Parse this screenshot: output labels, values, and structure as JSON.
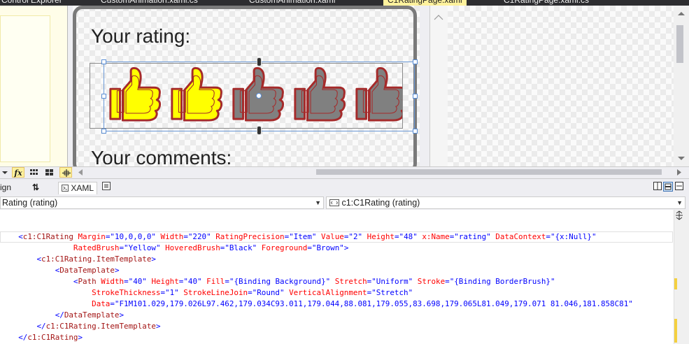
{
  "doc_tabs": [
    {
      "label": "Control Explorer",
      "active": false
    },
    {
      "label": "CustomAnimation.xaml.cs",
      "active": false
    },
    {
      "label": "CustomAnimation.xaml",
      "active": false
    },
    {
      "label": "C1RatingPage.xaml",
      "active": true
    },
    {
      "label": "C1RatingPage.xaml.cs",
      "active": false
    }
  ],
  "designer": {
    "your_rating": "Your rating:",
    "your_comments": "Your comments:",
    "rating": {
      "value": 2,
      "max": 5,
      "rated_fill": "#ffff00",
      "unrated_fill": "#808080",
      "stroke": "#a52a2a"
    }
  },
  "toolbar": {
    "fx_label": "fx"
  },
  "split": {
    "design_label": "ign",
    "swap_label": "⇅",
    "xaml_label": "XAML"
  },
  "combos": {
    "left": "Rating (rating)",
    "right": "c1:C1Rating (rating)"
  },
  "code": {
    "lines": [
      "",
      "",
      "",
      "",
      "",
      "",
      "",
      "",
      "",
      "",
      "",
      ""
    ],
    "l1": {
      "ind": "    ",
      "tag": "<c1:C1Rating",
      "rest": [
        [
          "Margin",
          "10,0,0,0"
        ],
        [
          "Width",
          "220"
        ],
        [
          "RatingPrecision",
          "Item"
        ],
        [
          "Value",
          "2"
        ],
        [
          "Height",
          "48"
        ],
        [
          "x:Name",
          "rating"
        ],
        [
          "DataContext",
          "{x:Null}"
        ]
      ]
    },
    "l2": {
      "ind": "                ",
      "rest": [
        [
          "RatedBrush",
          "Yellow"
        ],
        [
          "HoveredBrush",
          "Black"
        ],
        [
          "Foreground",
          "Brown"
        ]
      ],
      "end": ">"
    },
    "l3": {
      "ind": "        ",
      "tag": "<c1:C1Rating.ItemTemplate>"
    },
    "l4": {
      "ind": "            ",
      "tag": "<DataTemplate>"
    },
    "l5": {
      "ind": "                ",
      "tag": "<Path",
      "rest": [
        [
          "Width",
          "40"
        ],
        [
          "Height",
          "40"
        ],
        [
          "Fill",
          "{Binding Background}"
        ],
        [
          "Stretch",
          "Uniform"
        ],
        [
          "Stroke",
          "{Binding BorderBrush}"
        ]
      ]
    },
    "l6": {
      "ind": "                    ",
      "rest": [
        [
          "StrokeThickness",
          "1"
        ],
        [
          "StrokeLineJoin",
          "Round"
        ],
        [
          "VerticalAlignment",
          "Stretch"
        ]
      ]
    },
    "l7": {
      "ind": "                    ",
      "rest": [
        [
          "Data",
          "F1M101.029,179.026L97.462,179.034C93.011,179.044,88.081,179.055,83.698,179.065L81.049,179.071 81.046,181.858C81"
        ]
      ]
    },
    "l8": {
      "ind": "            ",
      "tag": "</DataTemplate>"
    },
    "l9": {
      "ind": "        ",
      "tag": "</c1:C1Rating.ItemTemplate>"
    },
    "l10": {
      "ind": "    ",
      "tag": "</c1:C1Rating>"
    }
  }
}
